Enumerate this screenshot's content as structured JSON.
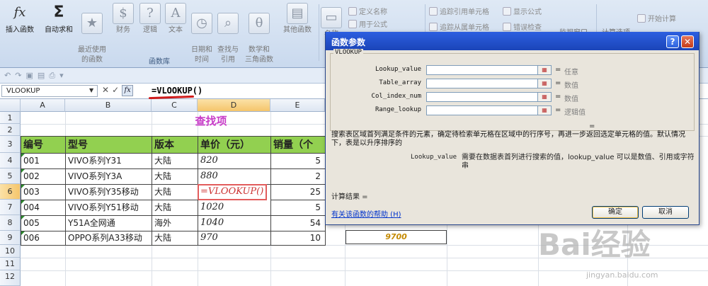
{
  "ribbon": {
    "buttons": [
      {
        "label": "插入函数",
        "icon": "fx"
      },
      {
        "label": "自动求和",
        "icon": "Σ"
      },
      {
        "label": "最近使用\n的函数",
        "icon": "★"
      },
      {
        "label": "财务",
        "icon": "$"
      },
      {
        "label": "逻辑",
        "icon": "?"
      },
      {
        "label": "文本",
        "icon": "A"
      },
      {
        "label": "日期和\n时间",
        "icon": "◷"
      },
      {
        "label": "查找与\n引用",
        "icon": "⌕"
      },
      {
        "label": "数学和\n三角函数",
        "icon": "θ"
      },
      {
        "label": "其他函数",
        "icon": "▤"
      }
    ],
    "group_label": "函数库",
    "define_name": "定义名称",
    "use_in_formula": "用于公式",
    "trace_precedents": "追踪引用单元格",
    "trace_dependents": "追踪从属单元格",
    "show_formulas": "显示公式",
    "error_checking": "错误检查",
    "start_calc": "开始计算",
    "partial_1": "名称",
    "partial_2": "监视窗口",
    "partial_3": "计算选项"
  },
  "formula_bar": {
    "name_box": "VLOOKUP",
    "formula": "=VLOOKUP()",
    "fx": "fx"
  },
  "columns": [
    "A",
    "B",
    "C",
    "D",
    "E"
  ],
  "rows": [
    "1",
    "2",
    "3",
    "4",
    "5",
    "6",
    "7",
    "8",
    "9",
    "10",
    "11",
    "12"
  ],
  "sheet": {
    "title": "查找项",
    "headers": [
      "编号",
      "型号",
      "版本",
      "单价（元）",
      "销量（个"
    ],
    "data": [
      {
        "id": "001",
        "model": "VIVO系列Y31",
        "version": "大陆",
        "price": "820",
        "sales": "5"
      },
      {
        "id": "002",
        "model": "VIVO系列Y3A",
        "version": "大陆",
        "price": "880",
        "sales": "2"
      },
      {
        "id": "003",
        "model": "VIVO系列Y35移动",
        "version": "大陆",
        "price": "=VLOOKUP()",
        "sales": "25"
      },
      {
        "id": "004",
        "model": "VIVO系列Y51移动",
        "version": "大陆",
        "price": "1020",
        "sales": "5"
      },
      {
        "id": "005",
        "model": "Y51A全网通",
        "version": "海外",
        "price": "1040",
        "sales": "54"
      },
      {
        "id": "006",
        "model": "OPPO系列A33移动",
        "version": "大陆",
        "price": "970",
        "sales": "10"
      }
    ],
    "extra_value": "9700"
  },
  "dialog": {
    "title": "函数参数",
    "help_btn": "?",
    "close_btn": "✕",
    "function_name": "VLOOKUP",
    "args": [
      {
        "name": "Lookup_value",
        "hint": "任意"
      },
      {
        "name": "Table_array",
        "hint": "数值"
      },
      {
        "name": "Col_index_num",
        "hint": "数值"
      },
      {
        "name": "Range_lookup",
        "hint": "逻辑值"
      }
    ],
    "eq": "=",
    "description": "搜索表区域首列满足条件的元素，确定待检索单元格在区域中的行序号，再进一步返回选定单元格的值。默认情况下，表是以升序排序的",
    "param_name": "Lookup_value",
    "param_desc": "需要在数据表首列进行搜索的值，lookup_value 可以是数值、引用或字符串",
    "calc_result": "计算结果 =",
    "help_link": "有关该函数的帮助 (H)",
    "ok": "确定",
    "cancel": "取消"
  },
  "watermark": {
    "brand": "Bai经验",
    "url": "jingyan.baidu.com"
  }
}
